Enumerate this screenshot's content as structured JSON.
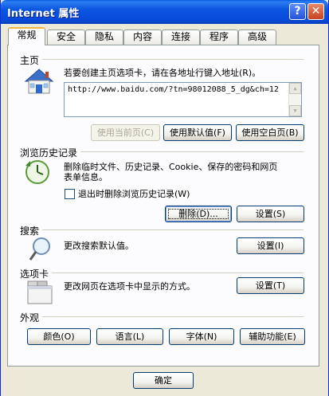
{
  "window": {
    "title": "Internet 属性",
    "help_label": "?",
    "close_label": "✕"
  },
  "tabs": [
    {
      "label": "常规",
      "active": true
    },
    {
      "label": "安全"
    },
    {
      "label": "隐私"
    },
    {
      "label": "内容"
    },
    {
      "label": "连接"
    },
    {
      "label": "程序"
    },
    {
      "label": "高级"
    }
  ],
  "home": {
    "section_label": "主页",
    "description": "若要创建主页选项卡，请在各地址行键入地址(R)。",
    "url_value": "http://www.baidu.com/?tn=98012088_5_dg&ch=12",
    "use_current_label": "使用当前页(C)",
    "use_default_label": "使用默认值(F)",
    "use_blank_label": "使用空白页(B)"
  },
  "history": {
    "section_label": "浏览历史记录",
    "description_line1": "删除临时文件、历史记录、Cookie、保存的密码和网页",
    "description_line2": "表单信息。",
    "checkbox_label": "退出时删除浏览历史记录(W)",
    "delete_label": "删除(D)...",
    "settings_label": "设置(S)"
  },
  "search": {
    "section_label": "搜索",
    "description": "更改搜索默认值。",
    "settings_label": "设置(I)"
  },
  "tabbed": {
    "section_label": "选项卡",
    "description": "更改网页在选项卡中显示的方式。",
    "settings_label": "设置(T)"
  },
  "appearance": {
    "section_label": "外观",
    "colors_label": "颜色(O)",
    "languages_label": "语言(L)",
    "fonts_label": "字体(N)",
    "accessibility_label": "辅助功能(E)"
  },
  "footer": {
    "ok_label": "确定"
  },
  "colors": {
    "titlebar": "#0a5ce8",
    "dialog_bg": "#ece9d8",
    "active_tab_accent": "#f7b33d",
    "button_border": "#003c74"
  }
}
